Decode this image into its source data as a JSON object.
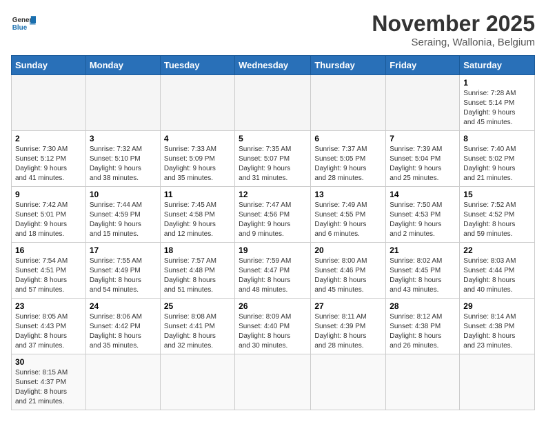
{
  "header": {
    "logo_general": "General",
    "logo_blue": "Blue",
    "month_title": "November 2025",
    "subtitle": "Seraing, Wallonia, Belgium"
  },
  "days_of_week": [
    "Sunday",
    "Monday",
    "Tuesday",
    "Wednesday",
    "Thursday",
    "Friday",
    "Saturday"
  ],
  "weeks": [
    [
      {
        "day": "",
        "info": "",
        "empty": true
      },
      {
        "day": "",
        "info": "",
        "empty": true
      },
      {
        "day": "",
        "info": "",
        "empty": true
      },
      {
        "day": "",
        "info": "",
        "empty": true
      },
      {
        "day": "",
        "info": "",
        "empty": true
      },
      {
        "day": "",
        "info": "",
        "empty": true
      },
      {
        "day": "1",
        "info": "Sunrise: 7:28 AM\nSunset: 5:14 PM\nDaylight: 9 hours\nand 45 minutes."
      }
    ],
    [
      {
        "day": "2",
        "info": "Sunrise: 7:30 AM\nSunset: 5:12 PM\nDaylight: 9 hours\nand 41 minutes."
      },
      {
        "day": "3",
        "info": "Sunrise: 7:32 AM\nSunset: 5:10 PM\nDaylight: 9 hours\nand 38 minutes."
      },
      {
        "day": "4",
        "info": "Sunrise: 7:33 AM\nSunset: 5:09 PM\nDaylight: 9 hours\nand 35 minutes."
      },
      {
        "day": "5",
        "info": "Sunrise: 7:35 AM\nSunset: 5:07 PM\nDaylight: 9 hours\nand 31 minutes."
      },
      {
        "day": "6",
        "info": "Sunrise: 7:37 AM\nSunset: 5:05 PM\nDaylight: 9 hours\nand 28 minutes."
      },
      {
        "day": "7",
        "info": "Sunrise: 7:39 AM\nSunset: 5:04 PM\nDaylight: 9 hours\nand 25 minutes."
      },
      {
        "day": "8",
        "info": "Sunrise: 7:40 AM\nSunset: 5:02 PM\nDaylight: 9 hours\nand 21 minutes."
      }
    ],
    [
      {
        "day": "9",
        "info": "Sunrise: 7:42 AM\nSunset: 5:01 PM\nDaylight: 9 hours\nand 18 minutes."
      },
      {
        "day": "10",
        "info": "Sunrise: 7:44 AM\nSunset: 4:59 PM\nDaylight: 9 hours\nand 15 minutes."
      },
      {
        "day": "11",
        "info": "Sunrise: 7:45 AM\nSunset: 4:58 PM\nDaylight: 9 hours\nand 12 minutes."
      },
      {
        "day": "12",
        "info": "Sunrise: 7:47 AM\nSunset: 4:56 PM\nDaylight: 9 hours\nand 9 minutes."
      },
      {
        "day": "13",
        "info": "Sunrise: 7:49 AM\nSunset: 4:55 PM\nDaylight: 9 hours\nand 6 minutes."
      },
      {
        "day": "14",
        "info": "Sunrise: 7:50 AM\nSunset: 4:53 PM\nDaylight: 9 hours\nand 2 minutes."
      },
      {
        "day": "15",
        "info": "Sunrise: 7:52 AM\nSunset: 4:52 PM\nDaylight: 8 hours\nand 59 minutes."
      }
    ],
    [
      {
        "day": "16",
        "info": "Sunrise: 7:54 AM\nSunset: 4:51 PM\nDaylight: 8 hours\nand 57 minutes."
      },
      {
        "day": "17",
        "info": "Sunrise: 7:55 AM\nSunset: 4:49 PM\nDaylight: 8 hours\nand 54 minutes."
      },
      {
        "day": "18",
        "info": "Sunrise: 7:57 AM\nSunset: 4:48 PM\nDaylight: 8 hours\nand 51 minutes."
      },
      {
        "day": "19",
        "info": "Sunrise: 7:59 AM\nSunset: 4:47 PM\nDaylight: 8 hours\nand 48 minutes."
      },
      {
        "day": "20",
        "info": "Sunrise: 8:00 AM\nSunset: 4:46 PM\nDaylight: 8 hours\nand 45 minutes."
      },
      {
        "day": "21",
        "info": "Sunrise: 8:02 AM\nSunset: 4:45 PM\nDaylight: 8 hours\nand 43 minutes."
      },
      {
        "day": "22",
        "info": "Sunrise: 8:03 AM\nSunset: 4:44 PM\nDaylight: 8 hours\nand 40 minutes."
      }
    ],
    [
      {
        "day": "23",
        "info": "Sunrise: 8:05 AM\nSunset: 4:43 PM\nDaylight: 8 hours\nand 37 minutes."
      },
      {
        "day": "24",
        "info": "Sunrise: 8:06 AM\nSunset: 4:42 PM\nDaylight: 8 hours\nand 35 minutes."
      },
      {
        "day": "25",
        "info": "Sunrise: 8:08 AM\nSunset: 4:41 PM\nDaylight: 8 hours\nand 32 minutes."
      },
      {
        "day": "26",
        "info": "Sunrise: 8:09 AM\nSunset: 4:40 PM\nDaylight: 8 hours\nand 30 minutes."
      },
      {
        "day": "27",
        "info": "Sunrise: 8:11 AM\nSunset: 4:39 PM\nDaylight: 8 hours\nand 28 minutes."
      },
      {
        "day": "28",
        "info": "Sunrise: 8:12 AM\nSunset: 4:38 PM\nDaylight: 8 hours\nand 26 minutes."
      },
      {
        "day": "29",
        "info": "Sunrise: 8:14 AM\nSunset: 4:38 PM\nDaylight: 8 hours\nand 23 minutes."
      }
    ],
    [
      {
        "day": "30",
        "info": "Sunrise: 8:15 AM\nSunset: 4:37 PM\nDaylight: 8 hours\nand 21 minutes."
      },
      {
        "day": "",
        "info": "",
        "empty": true
      },
      {
        "day": "",
        "info": "",
        "empty": true
      },
      {
        "day": "",
        "info": "",
        "empty": true
      },
      {
        "day": "",
        "info": "",
        "empty": true
      },
      {
        "day": "",
        "info": "",
        "empty": true
      },
      {
        "day": "",
        "info": "",
        "empty": true
      }
    ]
  ]
}
